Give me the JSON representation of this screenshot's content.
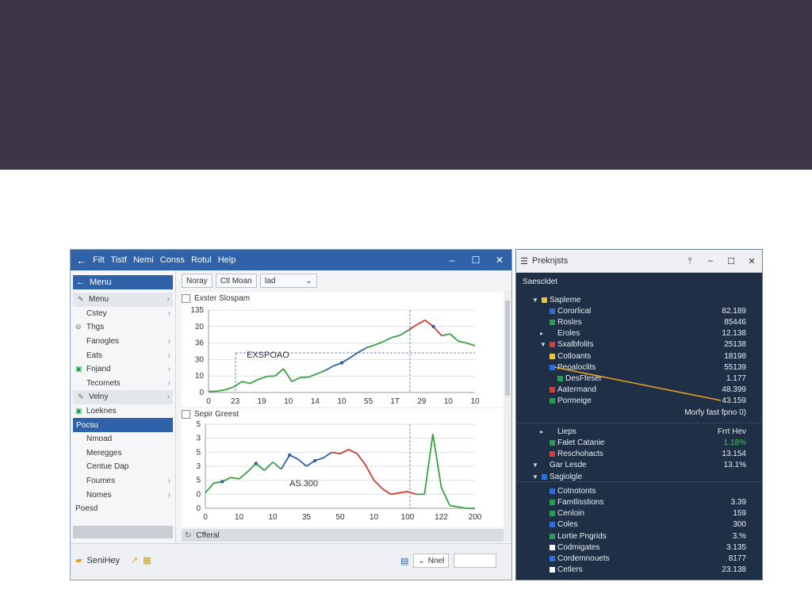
{
  "main_window": {
    "menu": [
      "Filt",
      "Tistf",
      "Nemi",
      "Conss",
      "Rotul",
      "Help"
    ],
    "sidebar": {
      "header": "Menu",
      "items": [
        {
          "label": "Menu",
          "kind": "group"
        },
        {
          "label": "Cstey"
        },
        {
          "label": "Thgs"
        },
        {
          "label": "Fanogles"
        },
        {
          "label": "Eats"
        },
        {
          "label": "Fnjand"
        },
        {
          "label": "Tecomets"
        },
        {
          "label": "Velny",
          "kind": "group"
        },
        {
          "label": "Loeknes"
        },
        {
          "label": "Pocsu",
          "kind": "selected"
        },
        {
          "label": "Nmoad"
        },
        {
          "label": "Meregges"
        },
        {
          "label": "Centue Dap"
        },
        {
          "label": "Foumes"
        },
        {
          "label": "Nomes"
        },
        {
          "label": "Poesd"
        }
      ]
    },
    "toolbar": {
      "tab1": "Noray",
      "tab2": "Ctl Moan",
      "dropdown": "Iad"
    },
    "status_text": "Cfferal",
    "bottom": {
      "button1": "SeniHey",
      "select": "Nnel"
    }
  },
  "chart_data": [
    {
      "type": "line",
      "title": "Exster Slospam",
      "annotation": "EXSPOAO",
      "y_ticks": [
        "135",
        "20",
        "36",
        "30",
        "10",
        "0"
      ],
      "x_ticks": [
        "0",
        "23",
        "19",
        "10",
        "14",
        "10",
        "55",
        "1T",
        "29",
        "10",
        "10"
      ],
      "ylim": [
        0,
        45
      ],
      "values": [
        0.6,
        0.7,
        1.5,
        3.0,
        6.0,
        5.0,
        7.2,
        8.8,
        9.0,
        13.0,
        6.0,
        8.2,
        8.4,
        10.2,
        12.0,
        14.5,
        16.2,
        19.0,
        22.0,
        24.5,
        26.0,
        27.8,
        30.0,
        31.2,
        34.0,
        37.0,
        39.5,
        36.0,
        31.0,
        32.0,
        28.0,
        27.0,
        25.5
      ]
    },
    {
      "type": "line",
      "title": "Sepir Greest",
      "annotation": "AS.300",
      "y_ticks": [
        "5",
        "3",
        "5",
        "3",
        "5",
        "0",
        "0"
      ],
      "x_ticks": [
        "0",
        "10",
        "10",
        "35",
        "50",
        "10",
        "100",
        "122",
        "200"
      ],
      "ylim": [
        0,
        6
      ],
      "values": [
        1.1,
        1.8,
        1.9,
        2.2,
        2.1,
        2.6,
        3.2,
        2.7,
        3.3,
        2.8,
        3.8,
        3.5,
        3.0,
        3.4,
        3.6,
        4.0,
        3.9,
        4.2,
        3.9,
        3.1,
        2.0,
        1.4,
        1.0,
        1.1,
        1.2,
        1.0,
        1.0,
        5.3,
        1.5,
        0.2,
        0.1,
        0.0,
        0.0
      ]
    }
  ],
  "properties_panel": {
    "title": "Preknjsts",
    "subtitle": "Saescldet",
    "rows": [
      {
        "indent": 1,
        "tri": "▼",
        "color": "#f2c230",
        "label": "Sapleme",
        "value": ""
      },
      {
        "indent": 2,
        "tri": "",
        "color": "#2d6ee6",
        "label": "Cororlical",
        "value": "82.189"
      },
      {
        "indent": 2,
        "tri": "",
        "color": "#1fa34a",
        "label": "Rosles",
        "value": "85446"
      },
      {
        "indent": 2,
        "tri": "▸",
        "color": "",
        "label": "Eroles",
        "value": "12.138"
      },
      {
        "indent": 2,
        "tri": "▼",
        "color": "#e03a2f",
        "label": "Sxalbfolits",
        "value": "25138"
      },
      {
        "indent": 2,
        "tri": "",
        "color": "#f2c230",
        "label": "Cotloants",
        "value": "18198"
      },
      {
        "indent": 2,
        "tri": "",
        "color": "#2d6ee6",
        "label": "Peoaloclits",
        "value": "55139"
      },
      {
        "indent": 3,
        "tri": "",
        "color": "#1fa34a",
        "label": "DesFfeser",
        "value": "1.177"
      },
      {
        "indent": 2,
        "tri": "",
        "color": "#e03a2f",
        "label": "Aatermand",
        "value": "48.399"
      },
      {
        "indent": 2,
        "tri": "",
        "color": "#1fa34a",
        "label": "Pormeige",
        "value": "43.159"
      },
      {
        "indent": 0,
        "tri": "",
        "color": "",
        "label": "",
        "value": "Morfy fast fpno 0)"
      },
      {
        "indent": 2,
        "tri": "▸",
        "color": "",
        "label": "Lieps",
        "value": "Frrt Hev"
      },
      {
        "indent": 2,
        "tri": "",
        "color": "#1fa34a",
        "label": "Falet Catanie",
        "value": "1.18%",
        "value_color": "#3ec25b"
      },
      {
        "indent": 2,
        "tri": "",
        "color": "#e03a2f",
        "label": "Reschohacts",
        "value": "13.154"
      },
      {
        "indent": 1,
        "tri": "▼",
        "color": "",
        "label": "Gar Lesde",
        "value": "13.1%"
      },
      {
        "indent": 1,
        "tri": "▼",
        "color": "#2d6ee6",
        "label": "Sagiolgle",
        "value": ""
      },
      {
        "indent": 2,
        "tri": "",
        "color": "#2d6ee6",
        "label": "Cotnotonts",
        "value": ""
      },
      {
        "indent": 2,
        "tri": "",
        "color": "#1fa34a",
        "label": "Famtlisstions",
        "value": "3.39"
      },
      {
        "indent": 2,
        "tri": "",
        "color": "#1fa34a",
        "label": "Cenloin",
        "value": "159"
      },
      {
        "indent": 2,
        "tri": "",
        "color": "#2d6ee6",
        "label": "Coles",
        "value": "300"
      },
      {
        "indent": 2,
        "tri": "",
        "color": "#1fa34a",
        "label": "Lortie Pngrids",
        "value": "3.%"
      },
      {
        "indent": 2,
        "tri": "",
        "color": "#ffffff",
        "label": "Codmigates",
        "value": "3.135"
      },
      {
        "indent": 2,
        "tri": "",
        "color": "#2d6ee6",
        "label": "Cordemnouets",
        "value": "8177"
      },
      {
        "indent": 2,
        "tri": "",
        "color": "#ffffff",
        "label": "Cetlers",
        "value": "23.138"
      }
    ]
  }
}
